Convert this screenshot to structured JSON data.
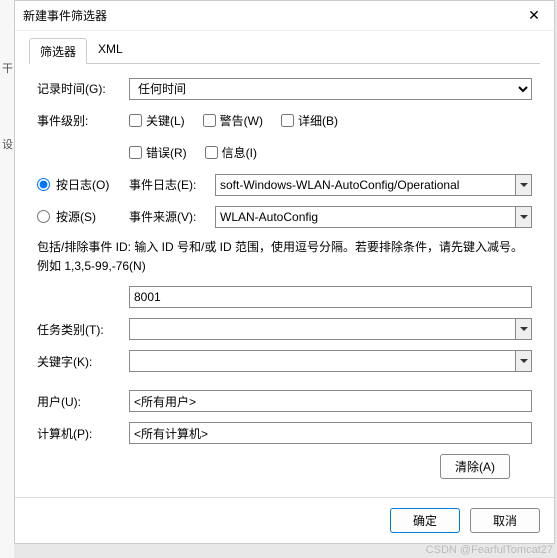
{
  "window": {
    "title": "新建事件筛选器"
  },
  "tabs": {
    "filter": "筛选器",
    "xml": "XML"
  },
  "logTime": {
    "label": "记录时间(G):",
    "value": "任何时间"
  },
  "level": {
    "label": "事件级别:",
    "critical": "关键(L)",
    "warning": "警告(W)",
    "verbose": "详细(B)",
    "error": "错误(R)",
    "info": "信息(I)"
  },
  "radio": {
    "byLog": "按日志(O)",
    "bySource": "按源(S)",
    "eventLogLabel": "事件日志(E):",
    "eventSourceLabel": "事件来源(V):",
    "eventLogValue": "soft-Windows-WLAN-AutoConfig/Operational",
    "eventSourceValue": "WLAN-AutoConfig"
  },
  "idHelp": "包括/排除事件 ID: 输入 ID 号和/或 ID 范围，使用逗号分隔。若要排除条件，请先键入减号。例如 1,3,5-99,-76(N)",
  "eventId": {
    "value": "8001"
  },
  "taskCategory": {
    "label": "任务类别(T):",
    "value": ""
  },
  "keywords": {
    "label": "关键字(K):",
    "value": ""
  },
  "user": {
    "label": "用户(U):",
    "value": "<所有用户>"
  },
  "computer": {
    "label": "计算机(P):",
    "value": "<所有计算机>"
  },
  "buttons": {
    "clear": "清除(A)",
    "ok": "确定",
    "cancel": "取消"
  },
  "leftStrip": {
    "t1": "干",
    "t2": "设"
  },
  "watermark": "CSDN @FearfulTomcat27"
}
